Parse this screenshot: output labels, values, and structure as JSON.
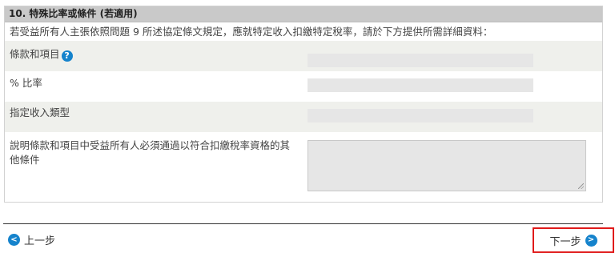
{
  "section": {
    "title": "10. 特殊比率或條件 (若適用)",
    "intro": "若受益所有人主張依照問題 9 所述協定條文規定，應就特定收入扣繳特定稅率，請於下方提供所需詳細資料："
  },
  "fields": {
    "clause_label": "條款和項目",
    "help_glyph": "?",
    "rate_label": "% 比率",
    "income_type_label": "指定收入類型",
    "conditions_label": "說明條款和項目中受益所有人必須通過以符合扣繳稅率資格的其他條件"
  },
  "nav": {
    "prev_label": "上一步",
    "next_label": "下一步",
    "prev_icon": "chevron-left-icon",
    "next_icon": "chevron-right-icon"
  },
  "colors": {
    "accent": "#1583cc",
    "highlight_border": "#e01a1a"
  }
}
